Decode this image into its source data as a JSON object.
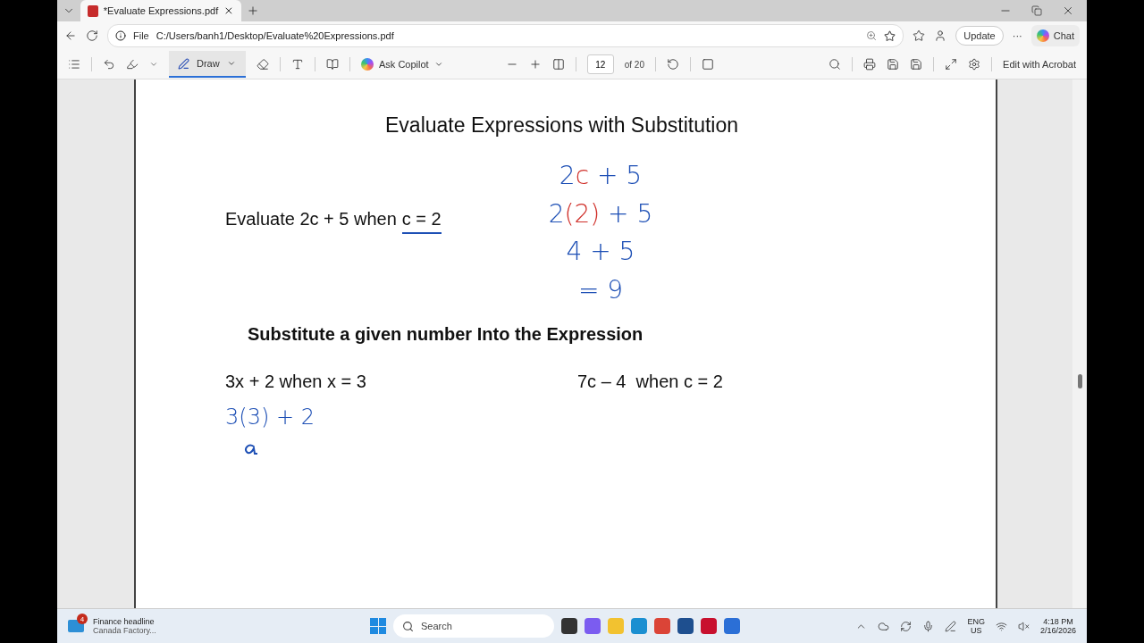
{
  "browser": {
    "tabs": [
      {
        "title": "*Evaluate Expressions.pdf",
        "selected": true
      }
    ],
    "address": {
      "scheme": "File",
      "url": "C:/Users/banh1/Desktop/Evaluate%20Expressions.pdf"
    },
    "update_button": "Update",
    "more_button": "···",
    "chat_button": "Chat"
  },
  "pdf_toolbar": {
    "draw_button": "Draw",
    "ask_copilot": "Ask Copilot",
    "page_number": "12",
    "page_total": "of 20",
    "edit_button": "Edit with Acrobat"
  },
  "page": {
    "title": "Evaluate Expressions with Substitution",
    "example": {
      "prompt": "Evaluate 2c + 5 when",
      "underlined": "c = 2"
    },
    "ink_lines": [
      {
        "segments": [
          {
            "text": "2",
            "color": "#1d4fb5"
          },
          {
            "text": "c",
            "color": "#d0302a"
          },
          {
            "text": " + 5",
            "color": "#1d4fb5"
          }
        ]
      },
      {
        "segments": [
          {
            "text": "2",
            "color": "#1d4fb5"
          },
          {
            "text": "(2)",
            "color": "#d0302a"
          },
          {
            "text": " + 5",
            "color": "#1d4fb5"
          }
        ]
      },
      {
        "segments": [
          {
            "text": "4 + 5",
            "color": "#1d4fb5"
          }
        ]
      },
      {
        "segments": [
          {
            "text": "= 9",
            "color": "#1d4fb5"
          }
        ]
      }
    ],
    "heading": "Substitute a given number Into the Expression",
    "problems": [
      {
        "text": "3x + 2 when x = 3",
        "ink_lines": [
          {
            "segments": [
              {
                "text": "3(3) + 2",
                "color": "#1d4fb5"
              }
            ]
          }
        ],
        "partial_stroke": true
      },
      {
        "text": "7c – 4  when c = 2"
      }
    ]
  },
  "taskbar": {
    "news": {
      "badge": "4",
      "title": "Finance headline",
      "subtitle": "Canada Factory..."
    },
    "search_placeholder": "Search",
    "language": "ENG",
    "region": "US",
    "time": "4:18 PM",
    "date": "2/16/2026"
  }
}
